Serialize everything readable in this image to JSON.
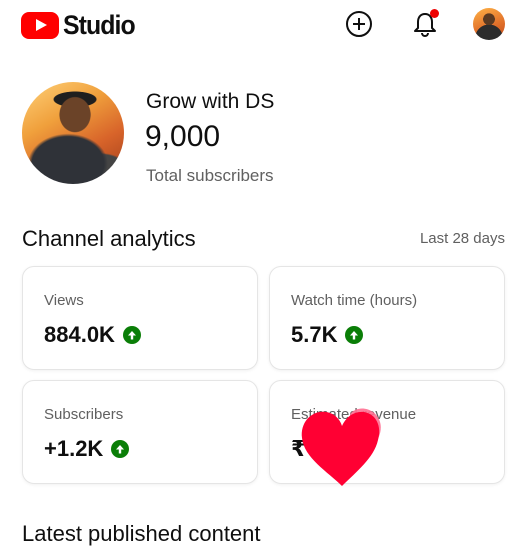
{
  "header": {
    "logo_text": "Studio",
    "icons": [
      "create-icon",
      "bell-icon",
      "avatar"
    ],
    "colors": {
      "brand": "#ff0000",
      "notification": "#e00000"
    }
  },
  "profile": {
    "channel_name": "Grow with DS",
    "subscriber_count": "9,000",
    "subscriber_label": "Total subscribers"
  },
  "analytics": {
    "title": "Channel analytics",
    "range": "Last 28 days",
    "cards": [
      {
        "label": "Views",
        "value": "884.0K",
        "trend": "up"
      },
      {
        "label": "Watch time (hours)",
        "value": "5.7K",
        "trend": "up"
      },
      {
        "label": "Subscribers",
        "value": "+1.2K",
        "trend": "up"
      },
      {
        "label": "Estimated revenue",
        "value": "₹",
        "trend": "obscured"
      }
    ],
    "trend_color": "#0a7e07"
  },
  "latest": {
    "title": "Latest published content"
  },
  "overlay": {
    "icon": "heart-icon",
    "colors": [
      "#ff0033",
      "#ff6f91"
    ]
  }
}
